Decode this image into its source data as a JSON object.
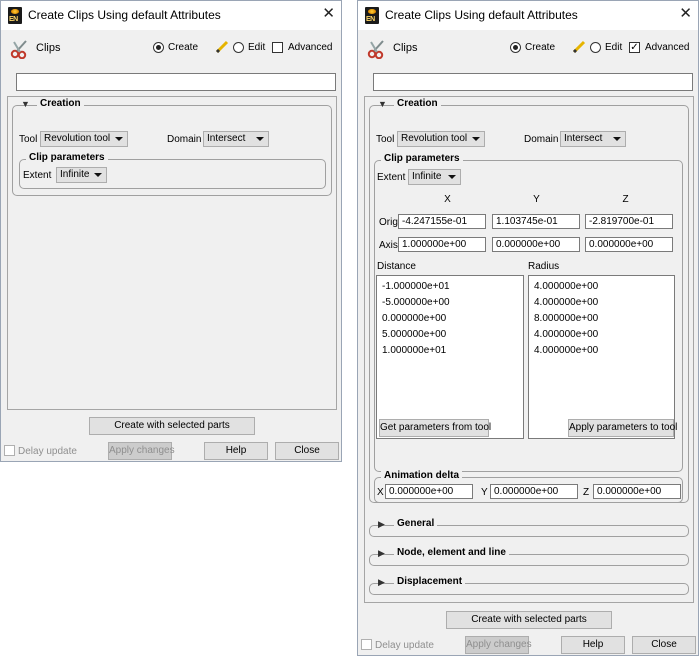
{
  "left": {
    "window_title": "Create Clips Using default Attributes",
    "header": {
      "clips_label": "Clips",
      "create_label": "Create",
      "edit_label": "Edit",
      "advanced_label": "Advanced",
      "advanced_checked": false
    },
    "creation": {
      "title": "Creation",
      "tool_label": "Tool",
      "tool_value": "Revolution tool",
      "domain_label": "Domain",
      "domain_value": "Intersect",
      "clip_params_title": "Clip parameters",
      "extent_label": "Extent",
      "extent_value": "Infinite"
    },
    "create_button": "Create with selected parts",
    "footer": {
      "delay_update": "Delay update",
      "apply_changes": "Apply changes",
      "help": "Help",
      "close": "Close"
    }
  },
  "right": {
    "window_title": "Create Clips Using default Attributes",
    "header": {
      "clips_label": "Clips",
      "create_label": "Create",
      "edit_label": "Edit",
      "advanced_label": "Advanced",
      "advanced_checked": true
    },
    "creation": {
      "title": "Creation",
      "tool_label": "Tool",
      "tool_value": "Revolution tool",
      "domain_label": "Domain",
      "domain_value": "Intersect",
      "clip_params_title": "Clip parameters",
      "extent_label": "Extent",
      "extent_value": "Infinite",
      "col_x": "X",
      "col_y": "Y",
      "col_z": "Z",
      "orig_label": "Orig",
      "orig": [
        "-4.247155e-01",
        "1.103745e-01",
        "-2.819700e-01"
      ],
      "axis_label": "Axis",
      "axis": [
        "1.000000e+00",
        "0.000000e+00",
        "0.000000e+00"
      ],
      "distance_label": "Distance",
      "distance_values": [
        "-1.000000e+01",
        "-5.000000e+00",
        "0.000000e+00",
        "5.000000e+00",
        "1.000000e+01"
      ],
      "radius_label": "Radius",
      "radius_values": [
        "4.000000e+00",
        "4.000000e+00",
        "8.000000e+00",
        "4.000000e+00",
        "4.000000e+00"
      ],
      "get_params_button": "Get parameters from tool",
      "apply_params_button": "Apply parameters to tool",
      "anim_title": "Animation delta",
      "anim_x_label": "X",
      "anim_x": "0.000000e+00",
      "anim_y_label": "Y",
      "anim_y": "0.000000e+00",
      "anim_z_label": "Z",
      "anim_z": "0.000000e+00"
    },
    "sections": {
      "general": "General",
      "node": "Node, element and line",
      "displacement": "Displacement"
    },
    "create_button": "Create with selected parts",
    "footer": {
      "delay_update": "Delay update",
      "apply_changes": "Apply changes",
      "help": "Help",
      "close": "Close"
    }
  }
}
